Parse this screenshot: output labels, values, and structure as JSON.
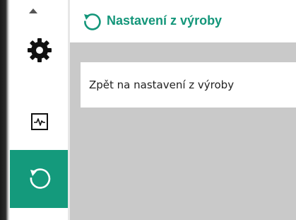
{
  "header": {
    "title": "Nastavení z výroby",
    "icon": "reset-arrow-icon",
    "accent_color": "#14967a"
  },
  "sidebar": {
    "items": [
      {
        "icon": "settings-gear-icon",
        "active": false
      },
      {
        "icon": "diagnostics-pulse-icon",
        "active": false
      },
      {
        "icon": "reset-arrow-icon",
        "active": true
      }
    ],
    "active_color": "#149a7c"
  },
  "menu": {
    "items": [
      {
        "label": "Zpět na nastavení z výroby"
      }
    ]
  }
}
